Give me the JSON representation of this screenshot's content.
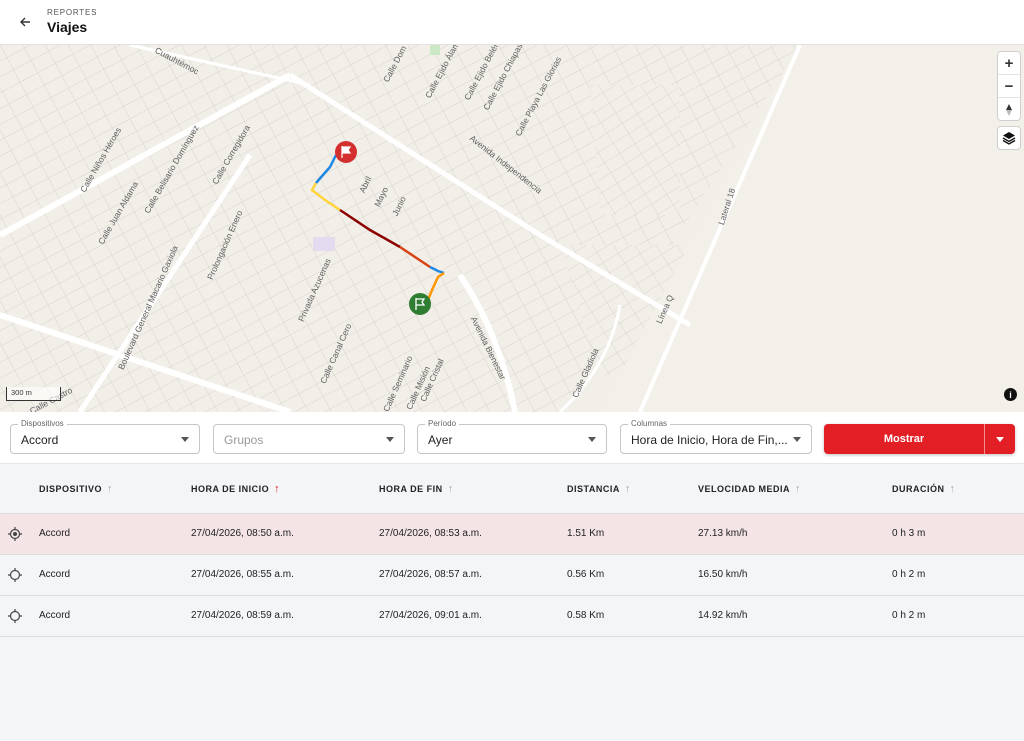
{
  "header": {
    "breadcrumb": "REPORTES",
    "title": "Viajes"
  },
  "map": {
    "scale_label": "300 m",
    "streets": [
      "Cuauhtémoc",
      "Calle Niños Héroes",
      "Calle Juan Aldama",
      "Calle Belisario Domínguez",
      "Calle Corregidora",
      "Boulevard General Macario Gaxiola",
      "Prolongación Enero",
      "Privada Azucenas",
      "Calle Canal Cero",
      "Calle Seminario",
      "Calle Misión",
      "Calle Cristal",
      "Avenida Bienestar",
      "Avenida Independencia",
      "Calle Ejido Álamo",
      "Calle Ejido Belén",
      "Calle Ejido Chiapas",
      "Calle Playa Las Glorias",
      "Calle Dom",
      "Abril",
      "Mayo",
      "Junio",
      "Lateral 18",
      "Línea Q",
      "Calle Gladiola",
      "Calle Castro"
    ],
    "route_colors": [
      "#1e88e5",
      "#ffd43b",
      "#ff9800",
      "#8b0000",
      "#2e7d32",
      "#d32f2f"
    ]
  },
  "filters": {
    "dispositivos": {
      "label": "Dispositivos",
      "value": "Accord"
    },
    "grupos": {
      "placeholder": "Grupos"
    },
    "periodo": {
      "label": "Período",
      "value": "Ayer"
    },
    "columnas": {
      "label": "Columnas",
      "value": "Hora de Inicio, Hora de Fin,..."
    },
    "show_button": "Mostrar"
  },
  "table": {
    "columns": [
      "DISPOSITIVO",
      "HORA DE INICIO",
      "HORA DE FIN",
      "DISTANCIA",
      "VELOCIDAD MEDIA",
      "DURACIÓN"
    ],
    "sort_up": "↑",
    "rows": [
      [
        "Accord",
        "27/04/2026, 08:50 a.m.",
        "27/04/2026, 08:53 a.m.",
        "1.51 Km",
        "27.13 km/h",
        "0 h 3 m"
      ],
      [
        "Accord",
        "27/04/2026, 08:55 a.m.",
        "27/04/2026, 08:57 a.m.",
        "0.56 Km",
        "16.50 km/h",
        "0 h 2 m"
      ],
      [
        "Accord",
        "27/04/2026, 08:59 a.m.",
        "27/04/2026, 09:01 a.m.",
        "0.58 Km",
        "14.92 km/h",
        "0 h 2 m"
      ]
    ]
  }
}
